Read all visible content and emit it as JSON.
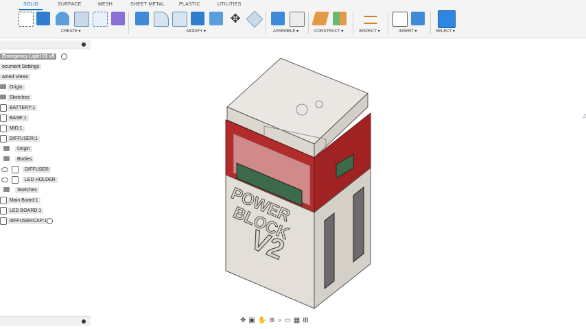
{
  "tabs": [
    "SOLID",
    "SURFACE",
    "MESH",
    "SHEET METAL",
    "PLASTIC",
    "UTILITIES"
  ],
  "active_tab": "SOLID",
  "groups": {
    "create": "CREATE ▾",
    "modify": "MODIFY ▾",
    "assemble": "ASSEMBLE ▾",
    "construct": "CONSTRUCT ▾",
    "inspect": "INSPECT ▾",
    "insert": "INSERT ▾",
    "select": "SELECT ▾"
  },
  "browser": {
    "root": "Emergency Light 01 v5",
    "items": [
      "ocument Settings",
      "amed Views",
      "Origin",
      "Sketches",
      "BATTERY:1",
      "BASE:1",
      "MID:1",
      "DIFFUSER:1",
      "Origin",
      "Bodies",
      "DIFFUSER",
      "LED HOLDER",
      "Sketches",
      "Main Board:1",
      "LED BOARD:1",
      "dIFFUSERCAP:1"
    ]
  },
  "model": {
    "text_line1": "POWER",
    "text_line2": "BLOCK",
    "text_line3": "V2"
  },
  "viewcube_label": "Z",
  "colors": {
    "accent": "#0b6fc2",
    "band_red": "#b32b2b",
    "shell": "#e3dfd8",
    "screen": "#3d6a4a"
  }
}
